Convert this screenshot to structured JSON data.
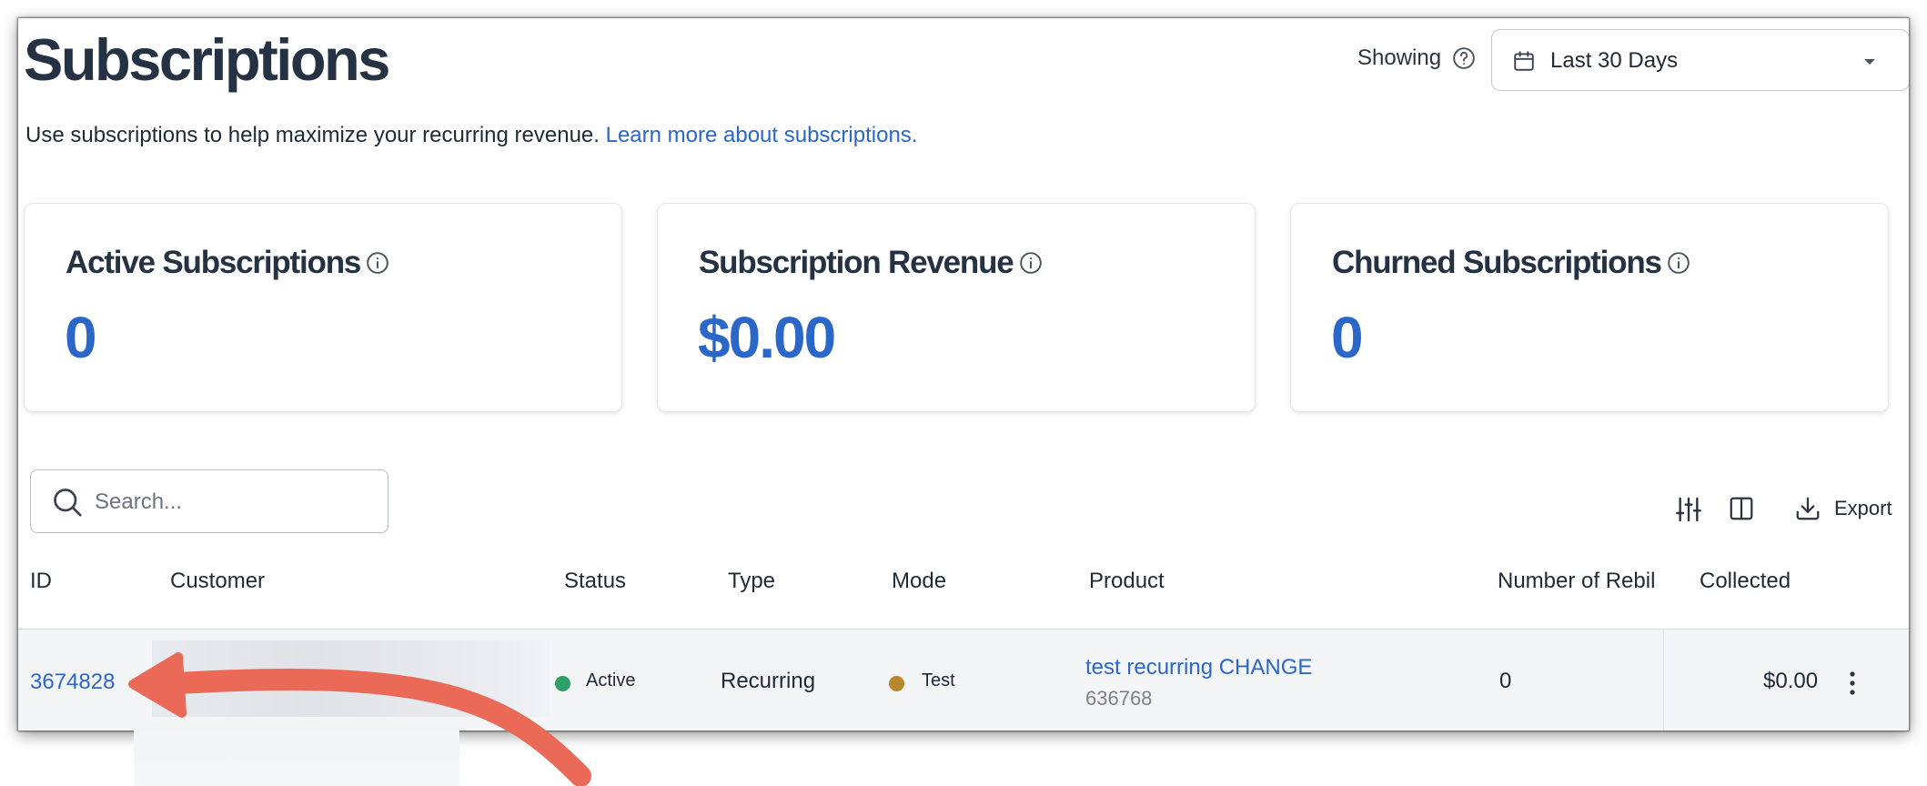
{
  "header": {
    "title": "Subscriptions",
    "showing_label": "Showing",
    "date_range": {
      "selected": "Last 30 Days"
    }
  },
  "subtitle": {
    "text": "Use subscriptions to help maximize your recurring revenue.",
    "link_text": "Learn more about subscriptions."
  },
  "cards": [
    {
      "title": "Active Subscriptions",
      "value": "0"
    },
    {
      "title": "Subscription Revenue",
      "value": "$0.00"
    },
    {
      "title": "Churned Subscriptions",
      "value": "0"
    }
  ],
  "toolbar": {
    "search_placeholder": "Search...",
    "export_label": "Export"
  },
  "table": {
    "columns": [
      "ID",
      "Customer",
      "Status",
      "Type",
      "Mode",
      "Product",
      "Number of Rebil",
      "Collected"
    ],
    "rows": [
      {
        "id": "3674828",
        "status": "Active",
        "type": "Recurring",
        "mode": "Test",
        "product_name": "test recurring CHANGE",
        "product_id": "636768",
        "rebills": "0",
        "collected": "$0.00"
      }
    ]
  },
  "colors": {
    "accent": "#2a67c9",
    "heading": "#243244",
    "status_active": "#2f9e69",
    "mode_test": "#b8862b",
    "annotation_arrow": "#ea6a57"
  },
  "icons": [
    "help-icon",
    "calendar-icon",
    "chevron-down-icon",
    "info-icon",
    "search-icon",
    "filter-icon",
    "columns-icon",
    "download-icon",
    "more-vertical-icon",
    "annotation-arrow"
  ]
}
